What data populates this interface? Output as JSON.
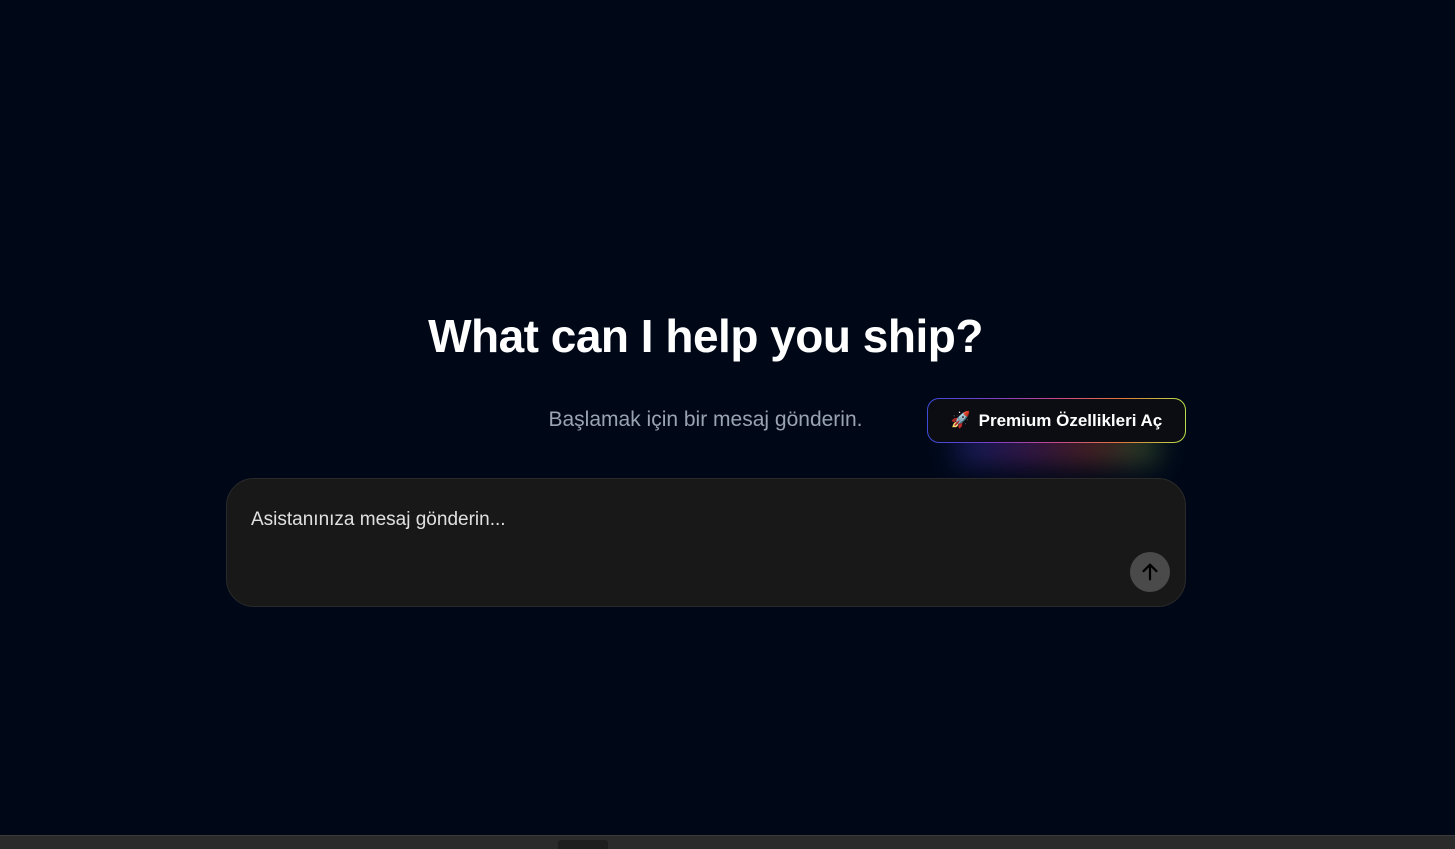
{
  "main": {
    "heading": "What can I help you ship?",
    "subtitle": "Başlamak için bir mesaj gönderin."
  },
  "premium": {
    "label": "Premium Özellikleri Aç",
    "icon": "rocket-icon"
  },
  "chat": {
    "placeholder": "Asistanınıza mesaj gönderin...",
    "send_icon": "arrow-up-icon"
  },
  "colors": {
    "background": "#000818",
    "chat_box": "#181818",
    "send_button": "#4a4a4a",
    "subtitle": "#9aa3b2"
  }
}
